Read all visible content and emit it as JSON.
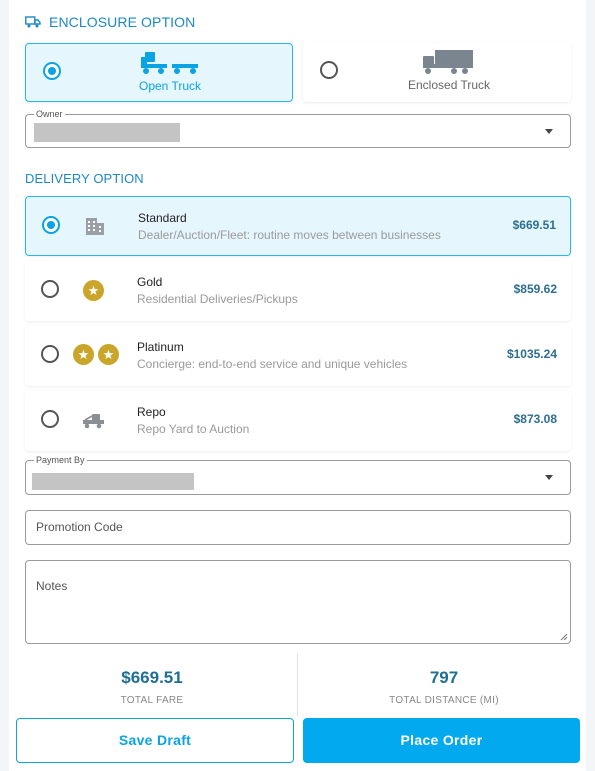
{
  "enclosure": {
    "title": "ENCLOSURE OPTION",
    "options": [
      {
        "label": "Open Truck",
        "selected": true
      },
      {
        "label": "Enclosed Truck",
        "selected": false
      }
    ],
    "owner_label": "Owner"
  },
  "delivery": {
    "title": "DELIVERY OPTION",
    "options": [
      {
        "name": "Standard",
        "desc": "Dealer/Auction/Fleet: routine moves between businesses",
        "price": "$669.51",
        "icon": "building-icon",
        "selected": true
      },
      {
        "name": "Gold",
        "desc": "Residential Deliveries/Pickups",
        "price": "$859.62",
        "icon": "star-icon",
        "selected": false
      },
      {
        "name": "Platinum",
        "desc": "Concierge: end-to-end service and unique vehicles",
        "price": "$1035.24",
        "icon": "two-stars-icon",
        "selected": false
      },
      {
        "name": "Repo",
        "desc": "Repo Yard to Auction",
        "price": "$873.08",
        "icon": "tow-truck-icon",
        "selected": false
      }
    ]
  },
  "payment": {
    "label": "Payment By"
  },
  "promo": {
    "placeholder": "Promotion Code"
  },
  "notes": {
    "placeholder": "Notes"
  },
  "summary": {
    "total_fare": "$669.51",
    "total_fare_label": "TOTAL FARE",
    "total_distance": "797",
    "total_distance_label": "TOTAL DISTANCE (MI)"
  },
  "actions": {
    "save_draft": "Save Draft",
    "place_order": "Place Order"
  },
  "colors": {
    "accent": "#03a9ee",
    "title": "#1d88c6",
    "price": "#2d6d8f",
    "gold": "#c9a62a"
  }
}
